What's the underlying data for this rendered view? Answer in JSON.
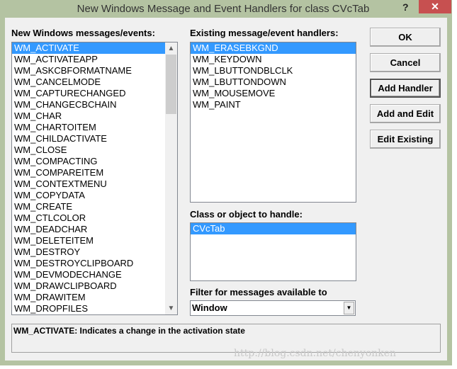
{
  "window": {
    "title": "New Windows Message and Event Handlers for class CVcTab",
    "help": "?",
    "close": "✕"
  },
  "messages": {
    "label": "New Windows messages/events:",
    "items": [
      "WM_ACTIVATE",
      "WM_ACTIVATEAPP",
      "WM_ASKCBFORMATNAME",
      "WM_CANCELMODE",
      "WM_CAPTURECHANGED",
      "WM_CHANGECBCHAIN",
      "WM_CHAR",
      "WM_CHARTOITEM",
      "WM_CHILDACTIVATE",
      "WM_CLOSE",
      "WM_COMPACTING",
      "WM_COMPAREITEM",
      "WM_CONTEXTMENU",
      "WM_COPYDATA",
      "WM_CREATE",
      "WM_CTLCOLOR",
      "WM_DEADCHAR",
      "WM_DELETEITEM",
      "WM_DESTROY",
      "WM_DESTROYCLIPBOARD",
      "WM_DEVMODECHANGE",
      "WM_DRAWCLIPBOARD",
      "WM_DRAWITEM",
      "WM_DROPFILES"
    ],
    "selected": 0
  },
  "handlers": {
    "label": "Existing message/event handlers:",
    "items": [
      "WM_ERASEBKGND",
      "WM_KEYDOWN",
      "WM_LBUTTONDBLCLK",
      "WM_LBUTTONDOWN",
      "WM_MOUSEMOVE",
      "WM_PAINT"
    ],
    "selected": 0
  },
  "classes": {
    "label": "Class or object to handle:",
    "items": [
      "CVcTab"
    ],
    "selected": 0
  },
  "filter": {
    "label": "Filter for messages available to",
    "value": "Window"
  },
  "buttons": {
    "ok": "OK",
    "cancel": "Cancel",
    "add_handler": "Add Handler",
    "add_edit": "Add and Edit",
    "edit_existing": "Edit Existing"
  },
  "status": "WM_ACTIVATE:  Indicates a change in the activation state",
  "watermark": "http://blog.csdn.net/chenyonken"
}
